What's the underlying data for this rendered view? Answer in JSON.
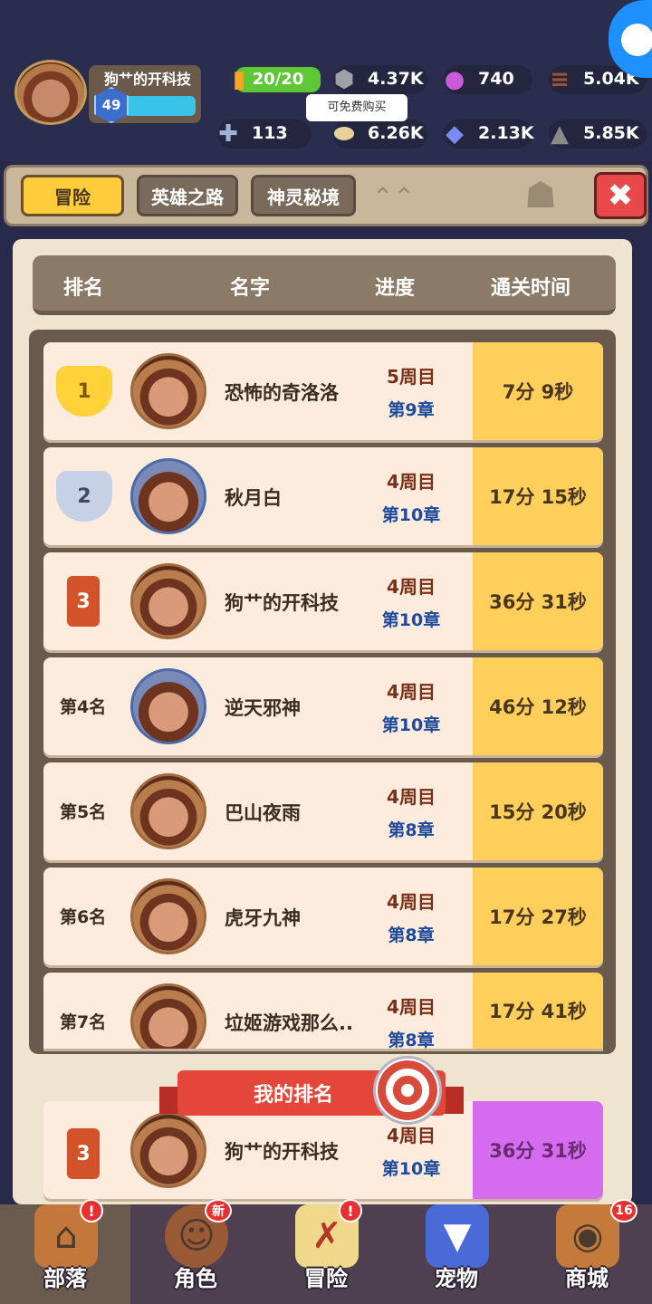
{
  "player": {
    "name": "狗艹的开科技",
    "level": "49"
  },
  "resources": {
    "energy": "20/20",
    "stone": "4.37K",
    "orb": "740",
    "wood": "5.04K",
    "bone": "113",
    "egg": "6.26K",
    "gem": "2.13K",
    "ore": "5.85K"
  },
  "tooltip": "可免费购买",
  "tabs": {
    "adventure": "冒险",
    "hero_road": "英雄之路",
    "spirit_realm": "神灵秘境"
  },
  "close_label": "✖",
  "table_headers": {
    "rank": "排名",
    "name": "名字",
    "progress": "进度",
    "time": "通关时间"
  },
  "rankings": [
    {
      "rank": "1",
      "name": "恐怖的奇洛洛",
      "week": "5周目",
      "chapter": "第9章",
      "time": "7分 9秒"
    },
    {
      "rank": "2",
      "name": "秋月白",
      "week": "4周目",
      "chapter": "第10章",
      "time": "17分 15秒"
    },
    {
      "rank": "3",
      "name": "狗艹的开科技",
      "week": "4周目",
      "chapter": "第10章",
      "time": "36分 31秒"
    },
    {
      "rank": "第4名",
      "name": "逆天邪神",
      "week": "4周目",
      "chapter": "第10章",
      "time": "46分 12秒"
    },
    {
      "rank": "第5名",
      "name": "巴山夜雨",
      "week": "4周目",
      "chapter": "第8章",
      "time": "15分 20秒"
    },
    {
      "rank": "第6名",
      "name": "虎牙九神",
      "week": "4周目",
      "chapter": "第8章",
      "time": "17分 27秒"
    },
    {
      "rank": "第7名",
      "name": "垃姬游戏那么..",
      "week": "4周目",
      "chapter": "第8章",
      "time": "17分 41秒"
    }
  ],
  "my_rank": {
    "title": "我的排名",
    "rank": "3",
    "name": "狗艹的开科技",
    "week": "4周目",
    "chapter": "第10章",
    "time": "36分 31秒"
  },
  "nav": {
    "tribe": "部落",
    "role": "角色",
    "adventure": "冒险",
    "pet": "宠物",
    "shop": "商城",
    "tribe_badge": "!",
    "role_badge": "新",
    "adventure_badge": "!",
    "shop_badge": "16"
  },
  "colors": {
    "gold": "#ffcf5c",
    "purple_highlight": "#d56cf0",
    "accent_red": "#e4463a"
  }
}
